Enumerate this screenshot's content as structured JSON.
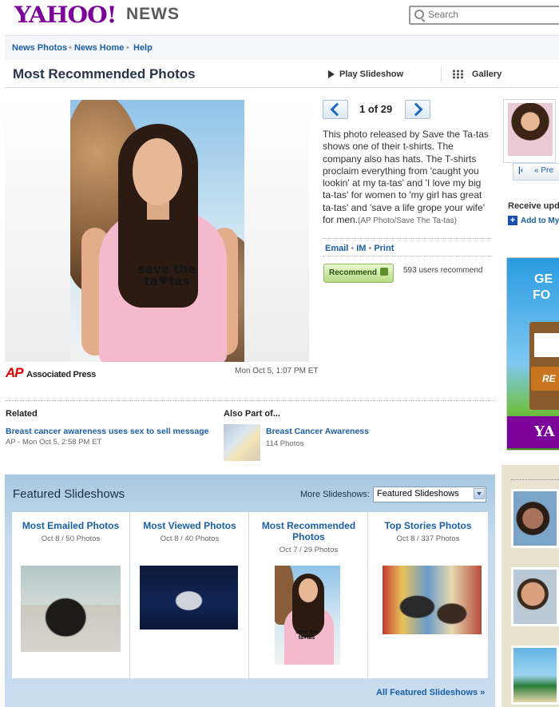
{
  "header": {
    "logo_text": "YAHOO!",
    "logo_section": "NEWS",
    "search_placeholder": "Search"
  },
  "nav": {
    "items": [
      "News Photos",
      "News Home",
      "Help"
    ]
  },
  "title_bar": {
    "title": "Most Recommended Photos",
    "play_label": "Play Slideshow",
    "gallery_label": "Gallery"
  },
  "photo": {
    "shirt_text_line1": "save the",
    "shirt_text_line2": "ta♥tas",
    "source_logo": "AP",
    "source_name": "Associated Press",
    "timestamp": "Mon Oct 5, 1:07 PM ET"
  },
  "pager": {
    "current": "1 of 29"
  },
  "caption": {
    "text": "This photo released by Save the Ta-tas shows one of their t-shirts. The company also has hats. The T-shirts proclaim everything from 'caught you lookin' at my ta-tas' and 'I love my big ta-tas' for women to 'my girl has great ta-tas' and 'save a life grope your wife' for men.",
    "credit": "(AP Photo/Save The Ta-tas)"
  },
  "share": {
    "email": "Email",
    "im": "IM",
    "print": "Print"
  },
  "recommend": {
    "button_label": "Recommend",
    "count_text": "593 users recommend"
  },
  "related": {
    "heading": "Related",
    "link": "Breast cancer awareness uses sex to sell message",
    "meta": "AP - Mon Oct 5, 2:58 PM ET"
  },
  "also": {
    "heading": "Also Part of...",
    "link": "Breast Cancer Awareness",
    "meta": "114 Photos"
  },
  "featured": {
    "title": "Featured Slideshows",
    "more_label": "More Slideshows:",
    "select_value": "Featured Slideshows",
    "cards": [
      {
        "title": "Most Emailed Photos",
        "meta": "Oct 8 / 50 Photos"
      },
      {
        "title": "Most Viewed Photos",
        "meta": "Oct 8 / 40 Photos"
      },
      {
        "title": "Most Recommended Photos",
        "meta": "Oct 7 / 29 Photos"
      },
      {
        "title": "Top Stories Photos",
        "meta": "Oct 8 / 337 Photos"
      }
    ],
    "all_link": "All Featured Slideshows »"
  },
  "sidebar": {
    "nav_label": "« Pre",
    "rss_title": "Receive upd",
    "rss_link": "Add to My",
    "ad_line1": "GE",
    "ad_line2": "FO",
    "ad_button": "RE",
    "ad_brand": "YA"
  },
  "colors": {
    "brand_purple": "#7b0099",
    "link_blue": "#1a5fa6",
    "featured_bg": "#c6dcee"
  }
}
